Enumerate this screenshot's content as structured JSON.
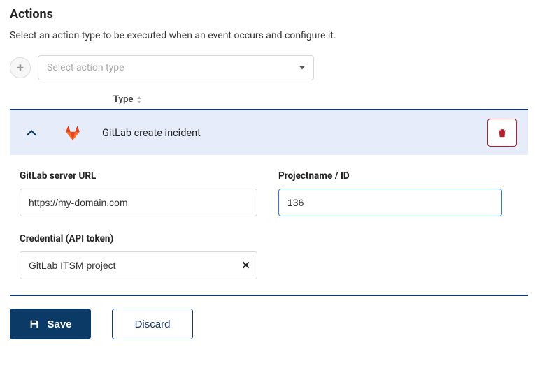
{
  "header": {
    "title": "Actions",
    "subtitle": "Select an action type to be executed when an event occurs and configure it."
  },
  "selector": {
    "placeholder": "Select action type"
  },
  "table": {
    "type_column_label": "Type"
  },
  "action": {
    "name": "GitLab create incident",
    "icon_name": "gitlab-icon"
  },
  "fields": {
    "server_url": {
      "label": "GitLab server URL",
      "value": "https://my-domain.com"
    },
    "project": {
      "label": "Projectname / ID",
      "value": "136"
    },
    "credential": {
      "label": "Credential (API token)",
      "value": "GitLab ITSM project"
    }
  },
  "buttons": {
    "save": "Save",
    "discard": "Discard"
  }
}
